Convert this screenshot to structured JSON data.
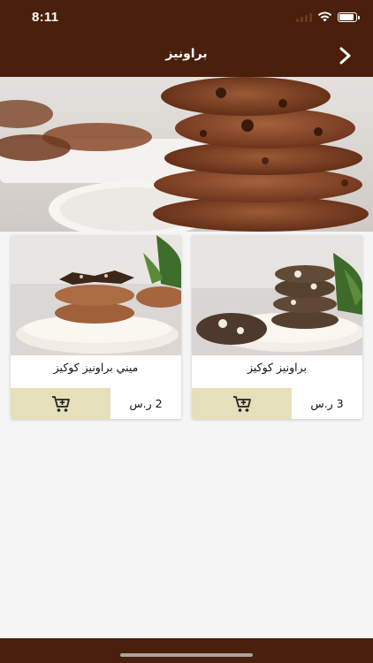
{
  "status_bar": {
    "time": "8:11",
    "icons": [
      "signal-icon",
      "wifi-icon",
      "battery-icon"
    ]
  },
  "header": {
    "title": "براونيز",
    "back_icon": "chevron-right-icon"
  },
  "hero": {
    "image": "stacked-brownie-cookies-banner"
  },
  "products": [
    {
      "name": "براونيز كوكيز",
      "price": "3 ر.س",
      "image": "brownie-cookies-photo",
      "cart_icon": "add-to-cart-icon"
    },
    {
      "name": "ميني براونيز كوكيز",
      "price": "2 ر.س",
      "image": "mini-brownie-cookies-photo",
      "cart_icon": "add-to-cart-icon"
    }
  ],
  "colors": {
    "primary": "#4a1f0c",
    "cart_button_bg": "#e5dfba",
    "background": "#f5f5f5"
  }
}
